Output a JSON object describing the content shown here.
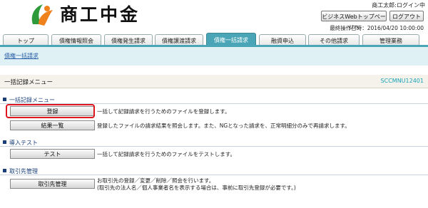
{
  "header": {
    "logo_text": "商工中金",
    "login_user": "商工太郎:ログイン中",
    "business_web_top_button": "ビジネスWebトップページへ",
    "logout_button": "ログアウト",
    "last_operation": "最終操作日時：2016/04/20 10:00:00",
    "logo_colors": {
      "green": "#2f9a3a",
      "orange": "#f0821e"
    }
  },
  "tabs": [
    {
      "label": "トップ",
      "active": false
    },
    {
      "label": "債権情報照会",
      "active": false
    },
    {
      "label": "債権発生請求",
      "active": false
    },
    {
      "label": "債権譲渡請求",
      "active": false
    },
    {
      "label": "債権一括請求",
      "active": true
    },
    {
      "label": "融資申込",
      "active": false
    },
    {
      "label": "その他請求",
      "active": false
    },
    {
      "label": "管理業務",
      "active": false
    }
  ],
  "subnav": {
    "link": "債権一括請求"
  },
  "page": {
    "title": "一括記録メニュー",
    "screen_id": "SCCMNU12401"
  },
  "sections": [
    {
      "heading": "一括記録メニュー",
      "rows": [
        {
          "button": "登録",
          "desc": "一括して記録請求を行うためのファイルを登録します。"
        },
        {
          "button": "結果一覧",
          "desc": "登録したファイルの請求結果を照会します。また、NGとなった請求を、正常明細分のみで再請求します。"
        }
      ]
    },
    {
      "heading": "導入テスト",
      "rows": [
        {
          "button": "テスト",
          "desc": "一括して記録請求を行うためのファイルをテストします。"
        }
      ]
    },
    {
      "heading": "取引先管理",
      "rows": [
        {
          "button": "取引先管理",
          "desc": "お取引先の登録／変更／削除／照会を行います。",
          "desc2": "(取引先の法人名／個人事業者名を表示する場合は、事前に取引先登録が必要です。)"
        }
      ]
    }
  ],
  "colors": {
    "accent": "#4aa6b6",
    "highlight": "#e0161e",
    "heading": "#1a3f78"
  }
}
